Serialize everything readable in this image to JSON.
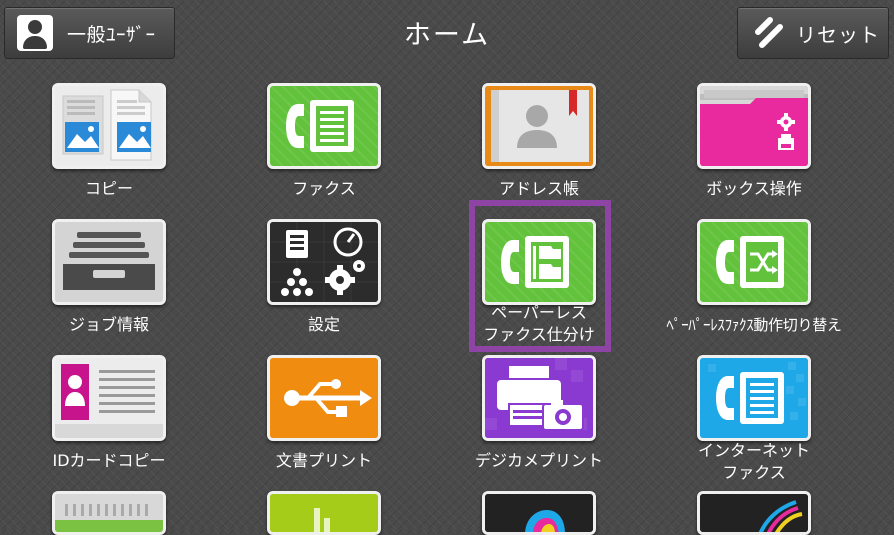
{
  "header": {
    "user_label": "一般ﾕｰｻﾞｰ",
    "title": "ホーム",
    "reset_label": "リセット"
  },
  "tiles": [
    {
      "label": "コピー",
      "icon": "copy-icon"
    },
    {
      "label": "ファクス",
      "icon": "fax-icon"
    },
    {
      "label": "アドレス帳",
      "icon": "address-book-icon"
    },
    {
      "label": "ボックス操作",
      "icon": "box-folder-icon"
    },
    {
      "label": "ジョブ情報",
      "icon": "job-tray-icon"
    },
    {
      "label": "設定",
      "icon": "settings-icon"
    },
    {
      "label_line1": "ペーパーレス",
      "label_line2": "ファクス仕分け",
      "icon": "paperless-fax-sort-icon",
      "selected": true
    },
    {
      "label": "ﾍﾟｰﾊﾟｰﾚｽﾌｧｸｽ動作切り替え",
      "icon": "paperless-fax-switch-icon"
    },
    {
      "label": "IDカードコピー",
      "icon": "id-card-icon"
    },
    {
      "label": "文書プリント",
      "icon": "usb-icon"
    },
    {
      "label": "デジカメプリント",
      "icon": "camera-print-icon"
    },
    {
      "label_line1": "インターネット",
      "label_line2": "ファクス",
      "icon": "internet-fax-icon"
    }
  ],
  "colors": {
    "fax_green": "#62c23c",
    "selection_purple": "#8e44a4",
    "usb_orange": "#f08c10",
    "camera_purple": "#8a3ad0",
    "internet_fax_cyan": "#1ea8e8",
    "box_magenta": "#e82a9e"
  }
}
